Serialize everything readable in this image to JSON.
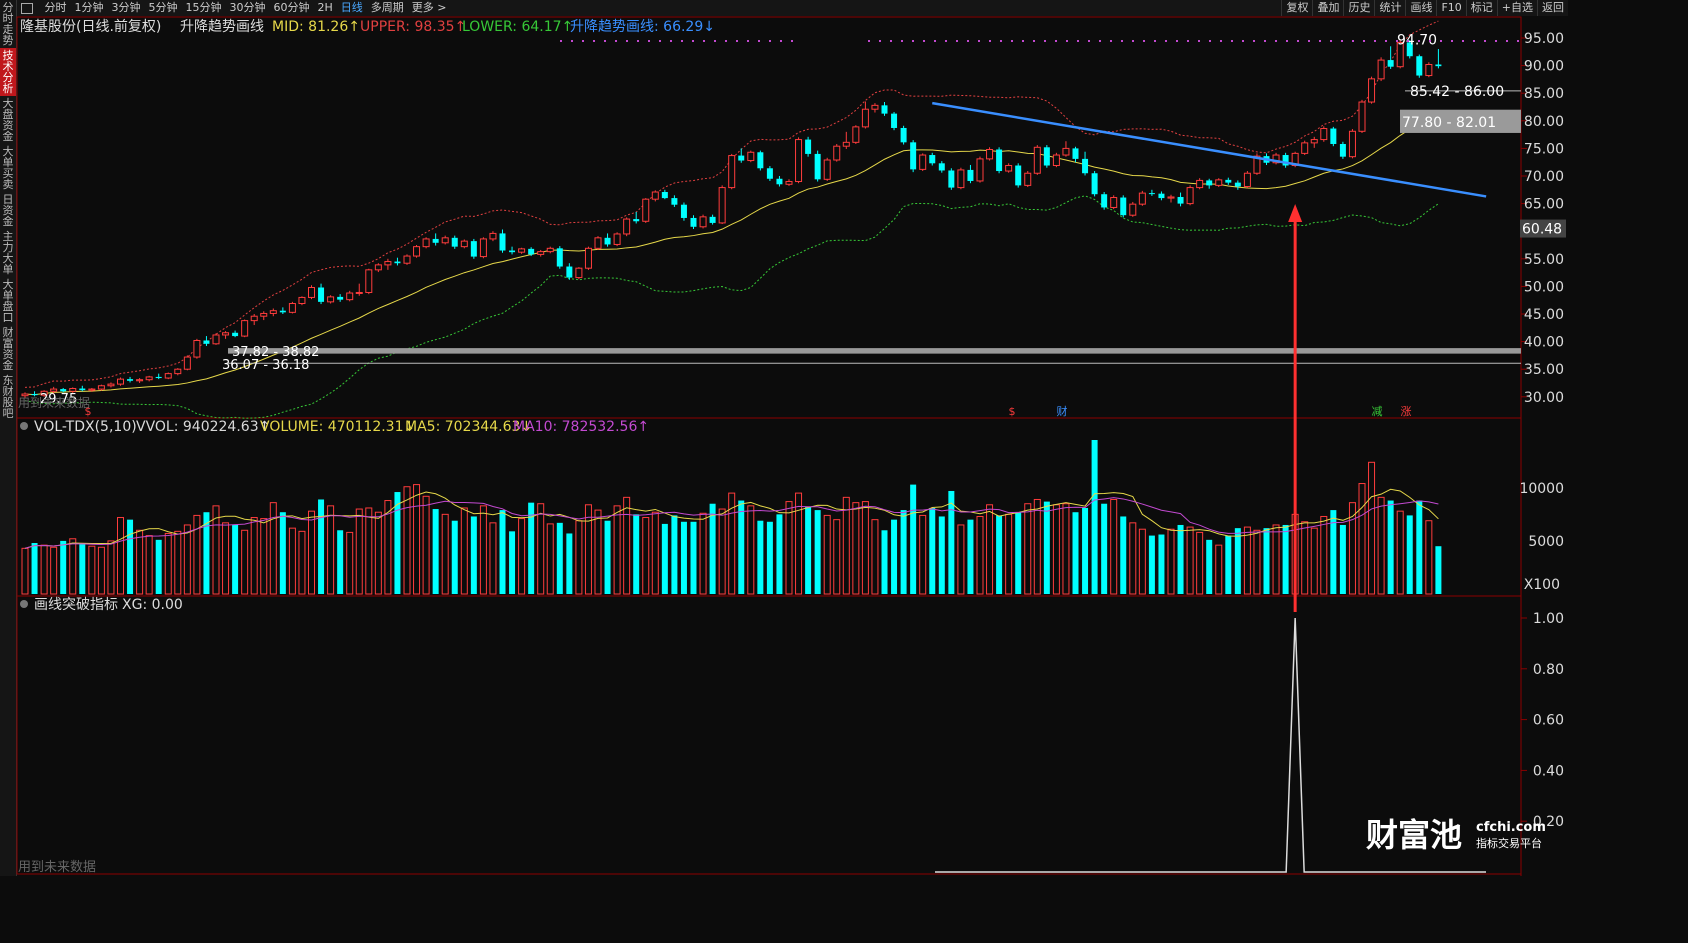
{
  "sidebar": {
    "items": [
      "分时走势",
      "技术分析",
      "大盘资金",
      "大单买卖",
      "日资金",
      "主力大单",
      "大单盘口",
      "财富资金",
      "东财股吧"
    ],
    "active": 1
  },
  "topbar": {
    "periods": [
      "分时",
      "1分钟",
      "3分钟",
      "5分钟",
      "15分钟",
      "30分钟",
      "60分钟",
      "2H",
      "日线",
      "多周期",
      "更多 >"
    ],
    "active_period": "日线",
    "right_menu": [
      "复权",
      "叠加",
      "历史",
      "统计",
      "画线",
      "F10",
      "标记",
      "+自选",
      "返回"
    ]
  },
  "indicator_bar": {
    "stock": "隆基股份(日线.前复权)",
    "study": "升降趋势画线",
    "items": [
      {
        "text": "MID: 81.26↑",
        "color": "#e6d84a"
      },
      {
        "text": "UPPER: 98.35↑",
        "color": "#e04040"
      },
      {
        "text": "LOWER: 64.17↑",
        "color": "#37c837"
      },
      {
        "text": "升降趋势画线: 66.29↓",
        "color": "#3a8fff"
      }
    ]
  },
  "vol_bar": {
    "name": "VOL-TDX(5,10)",
    "items": [
      {
        "text": "VVOL: 940224.63↑",
        "color": "#d8d8d8"
      },
      {
        "text": "VOLUME: 470112.31↓",
        "color": "#e6d84a"
      },
      {
        "text": "MA5: 702344.63↓",
        "color": "#e6d84a"
      },
      {
        "text": "MA10: 782532.56↑",
        "color": "#c34ad1"
      }
    ]
  },
  "xg_bar": {
    "name": "画线突破指标",
    "value": "XG: 0.00"
  },
  "annotations": {
    "high": "94.70",
    "box_top": "85.42 - 86.00",
    "box_mid": "77.80 - 82.01",
    "cur_price": "60.48",
    "box_low1": "37.82 - 38.82",
    "box_low2": "36.07 - 36.18",
    "low": "29.75",
    "marks": [
      "$",
      "$",
      "财",
      "减",
      "涨"
    ],
    "future_note": "用到未来数据",
    "future_note2": "用到未来数据"
  },
  "watermark": {
    "brand": "财富池",
    "site": "cfchi.com",
    "sub": "指标交易平台"
  },
  "colors": {
    "up": "#ff3c3c",
    "down": "#00ffff",
    "mid": "#e6d84a",
    "upper": "#e04040",
    "lower": "#37c837",
    "trend": "#3a8fff",
    "ma10": "#c34ad1",
    "arrow": "#ff3030",
    "grid": "#8b0000"
  },
  "chart_data": {
    "type": "candlestick",
    "price_axis": {
      "ticks": [
        95,
        90,
        85,
        80,
        75,
        70,
        65,
        60,
        55,
        50,
        45,
        40,
        35,
        30
      ],
      "labels": [
        "95.00",
        "90.00",
        "85.00",
        "80.00",
        "75.00",
        "70.00",
        "65.00",
        "60.00",
        "55.00",
        "50.00",
        "45.00",
        "40.00",
        "35.00",
        "30.00"
      ]
    },
    "volume_axis": {
      "labels": [
        "10000",
        "5000"
      ],
      "unit": "X100"
    },
    "xg_axis": {
      "labels": [
        "1.00",
        "0.80",
        "0.60",
        "0.40",
        "0.20"
      ]
    },
    "candles": [
      [
        30.2,
        30.8,
        29.8,
        30.5
      ],
      [
        30.5,
        31.0,
        30.1,
        30.3
      ],
      [
        30.3,
        31.2,
        30.0,
        31.0
      ],
      [
        31.0,
        31.8,
        30.6,
        31.4
      ],
      [
        31.4,
        31.6,
        30.8,
        31.0
      ],
      [
        31.0,
        31.7,
        30.7,
        31.5
      ],
      [
        31.5,
        32.0,
        31.0,
        31.2
      ],
      [
        31.2,
        31.6,
        30.9,
        31.4
      ],
      [
        31.4,
        32.2,
        31.1,
        32.0
      ],
      [
        32.0,
        32.6,
        31.7,
        32.3
      ],
      [
        32.3,
        33.5,
        32.0,
        33.2
      ],
      [
        33.2,
        33.6,
        32.6,
        32.9
      ],
      [
        32.9,
        33.4,
        32.5,
        33.1
      ],
      [
        33.1,
        33.8,
        32.8,
        33.6
      ],
      [
        33.6,
        34.2,
        33.2,
        33.4
      ],
      [
        33.4,
        34.4,
        33.2,
        34.2
      ],
      [
        34.2,
        35.2,
        33.9,
        35.0
      ],
      [
        35.0,
        37.5,
        34.8,
        37.2
      ],
      [
        37.2,
        40.5,
        36.9,
        40.2
      ],
      [
        40.2,
        41.0,
        39.2,
        39.6
      ],
      [
        39.6,
        41.5,
        39.4,
        41.2
      ],
      [
        41.2,
        41.9,
        40.5,
        41.6
      ],
      [
        41.6,
        42.0,
        40.8,
        41.0
      ],
      [
        41.0,
        44.0,
        40.8,
        43.8
      ],
      [
        43.8,
        45.0,
        43.0,
        44.6
      ],
      [
        44.6,
        45.5,
        43.9,
        45.1
      ],
      [
        45.1,
        46.0,
        44.6,
        45.6
      ],
      [
        45.6,
        46.2,
        45.0,
        45.3
      ],
      [
        45.3,
        47.2,
        45.1,
        46.9
      ],
      [
        46.9,
        48.2,
        46.6,
        48.0
      ],
      [
        48.0,
        50.2,
        47.7,
        49.8
      ],
      [
        49.8,
        50.5,
        46.8,
        47.2
      ],
      [
        47.2,
        48.4,
        46.9,
        48.1
      ],
      [
        48.1,
        48.6,
        47.2,
        47.6
      ],
      [
        47.6,
        49.2,
        47.3,
        48.8
      ],
      [
        48.8,
        50.5,
        48.3,
        48.9
      ],
      [
        48.9,
        53.2,
        48.6,
        53.0
      ],
      [
        53.0,
        54.2,
        52.6,
        53.9
      ],
      [
        53.9,
        55.0,
        53.0,
        54.5
      ],
      [
        54.5,
        55.2,
        53.8,
        54.2
      ],
      [
        54.2,
        55.8,
        53.9,
        55.5
      ],
      [
        55.5,
        57.5,
        55.2,
        57.2
      ],
      [
        57.2,
        58.9,
        56.9,
        58.6
      ],
      [
        58.6,
        59.6,
        57.4,
        57.9
      ],
      [
        57.9,
        59.2,
        57.6,
        58.8
      ],
      [
        58.8,
        59.2,
        56.8,
        57.2
      ],
      [
        57.2,
        58.5,
        56.9,
        58.2
      ],
      [
        58.2,
        58.6,
        55.0,
        55.4
      ],
      [
        55.4,
        58.9,
        55.1,
        58.6
      ],
      [
        58.6,
        60.0,
        58.2,
        59.6
      ],
      [
        59.6,
        60.3,
        56.1,
        56.5
      ],
      [
        56.5,
        57.2,
        55.8,
        56.2
      ],
      [
        56.2,
        57.0,
        55.9,
        56.8
      ],
      [
        56.8,
        57.1,
        55.5,
        55.8
      ],
      [
        55.8,
        56.6,
        55.4,
        56.3
      ],
      [
        56.3,
        57.2,
        56.0,
        56.9
      ],
      [
        56.9,
        57.3,
        53.2,
        53.6
      ],
      [
        53.6,
        54.2,
        51.2,
        51.6
      ],
      [
        51.6,
        53.5,
        51.3,
        53.3
      ],
      [
        53.3,
        57.2,
        53.0,
        56.9
      ],
      [
        56.9,
        59.1,
        56.6,
        58.8
      ],
      [
        58.8,
        59.6,
        57.2,
        57.6
      ],
      [
        57.6,
        59.8,
        57.3,
        59.5
      ],
      [
        59.5,
        62.5,
        59.1,
        62.2
      ],
      [
        62.2,
        63.5,
        61.4,
        61.8
      ],
      [
        61.8,
        66.0,
        61.5,
        65.8
      ],
      [
        65.8,
        67.4,
        65.4,
        67.1
      ],
      [
        67.1,
        67.5,
        65.8,
        66.0
      ],
      [
        66.0,
        66.5,
        64.4,
        64.8
      ],
      [
        64.8,
        65.2,
        61.9,
        62.4
      ],
      [
        62.4,
        62.9,
        60.4,
        60.8
      ],
      [
        60.8,
        63.0,
        60.5,
        62.6
      ],
      [
        62.6,
        63.0,
        61.2,
        61.5
      ],
      [
        61.5,
        68.3,
        61.3,
        67.9
      ],
      [
        67.9,
        74.0,
        67.6,
        73.7
      ],
      [
        73.7,
        75.0,
        72.4,
        72.8
      ],
      [
        72.8,
        74.6,
        72.5,
        74.3
      ],
      [
        74.3,
        74.6,
        71.0,
        71.4
      ],
      [
        71.4,
        71.8,
        69.1,
        69.5
      ],
      [
        69.5,
        70.0,
        68.1,
        68.5
      ],
      [
        68.5,
        69.4,
        68.2,
        69.0
      ],
      [
        69.0,
        77.0,
        68.7,
        76.6
      ],
      [
        76.6,
        77.1,
        73.5,
        74.0
      ],
      [
        74.0,
        74.6,
        69.0,
        69.4
      ],
      [
        69.4,
        73.3,
        69.1,
        72.9
      ],
      [
        72.9,
        75.8,
        72.6,
        75.4
      ],
      [
        75.4,
        78.0,
        74.9,
        76.1
      ],
      [
        76.1,
        79.2,
        75.8,
        78.9
      ],
      [
        78.9,
        83.5,
        78.6,
        82.1
      ],
      [
        82.1,
        83.2,
        81.5,
        82.8
      ],
      [
        82.8,
        83.4,
        80.9,
        81.3
      ],
      [
        81.3,
        81.6,
        78.3,
        78.7
      ],
      [
        78.7,
        79.1,
        75.7,
        76.1
      ],
      [
        76.1,
        76.5,
        70.7,
        71.2
      ],
      [
        71.2,
        74.1,
        70.9,
        73.8
      ],
      [
        73.8,
        74.2,
        71.9,
        72.3
      ],
      [
        72.3,
        72.7,
        70.6,
        71.0
      ],
      [
        71.0,
        71.4,
        67.5,
        67.9
      ],
      [
        67.9,
        71.5,
        67.6,
        71.1
      ],
      [
        71.1,
        72.0,
        68.7,
        69.1
      ],
      [
        69.1,
        73.5,
        68.8,
        73.1
      ],
      [
        73.1,
        75.2,
        72.8,
        74.8
      ],
      [
        74.8,
        75.2,
        70.5,
        70.9
      ],
      [
        70.9,
        72.3,
        70.6,
        71.9
      ],
      [
        71.9,
        72.3,
        67.9,
        68.3
      ],
      [
        68.3,
        70.9,
        68.0,
        70.5
      ],
      [
        70.5,
        75.6,
        70.2,
        75.2
      ],
      [
        75.2,
        75.6,
        71.5,
        71.9
      ],
      [
        71.9,
        74.2,
        71.6,
        73.8
      ],
      [
        73.8,
        76.3,
        73.5,
        75.0
      ],
      [
        75.0,
        75.3,
        72.5,
        73.1
      ],
      [
        73.1,
        74.4,
        70.1,
        70.5
      ],
      [
        70.5,
        70.9,
        66.3,
        66.7
      ],
      [
        66.7,
        67.1,
        63.9,
        64.3
      ],
      [
        64.3,
        66.5,
        64.0,
        66.1
      ],
      [
        66.1,
        66.5,
        62.5,
        62.9
      ],
      [
        62.9,
        65.3,
        62.6,
        64.9
      ],
      [
        64.9,
        67.3,
        64.6,
        66.9
      ],
      [
        66.9,
        67.5,
        66.4,
        66.8
      ],
      [
        66.8,
        67.2,
        65.6,
        66.0
      ],
      [
        66.0,
        66.6,
        65.2,
        66.2
      ],
      [
        66.2,
        67.0,
        64.5,
        65.0
      ],
      [
        65.0,
        68.3,
        64.7,
        67.9
      ],
      [
        67.9,
        69.6,
        67.6,
        69.2
      ],
      [
        69.2,
        69.5,
        67.7,
        68.3
      ],
      [
        68.3,
        69.6,
        68.0,
        69.3
      ],
      [
        69.3,
        69.7,
        68.4,
        68.8
      ],
      [
        68.8,
        69.2,
        67.5,
        68.1
      ],
      [
        68.1,
        70.9,
        67.8,
        70.5
      ],
      [
        70.5,
        74.1,
        70.2,
        73.6
      ],
      [
        73.6,
        74.1,
        72.0,
        72.4
      ],
      [
        72.4,
        74.2,
        72.1,
        73.8
      ],
      [
        73.8,
        74.2,
        71.5,
        71.9
      ],
      [
        71.9,
        74.4,
        71.6,
        74.1
      ],
      [
        74.1,
        76.4,
        73.8,
        76.0
      ],
      [
        76.0,
        77.1,
        75.1,
        76.6
      ],
      [
        76.6,
        79.0,
        76.2,
        78.6
      ],
      [
        78.6,
        78.9,
        75.4,
        75.8
      ],
      [
        75.8,
        76.2,
        73.1,
        73.5
      ],
      [
        73.5,
        78.5,
        73.2,
        78.1
      ],
      [
        78.1,
        83.8,
        77.8,
        83.4
      ],
      [
        83.4,
        88.0,
        83.1,
        87.6
      ],
      [
        87.6,
        91.5,
        87.2,
        91.0
      ],
      [
        91.0,
        93.5,
        89.4,
        89.8
      ],
      [
        89.8,
        94.7,
        89.5,
        94.2
      ],
      [
        94.2,
        94.6,
        91.3,
        91.7
      ],
      [
        91.7,
        92.0,
        87.8,
        88.2
      ],
      [
        88.2,
        90.6,
        87.9,
        90.2
      ],
      [
        90.2,
        93.0,
        89.5,
        89.9
      ]
    ],
    "volumes": [
      4300,
      4800,
      4600,
      4400,
      5000,
      5200,
      4700,
      4500,
      4400,
      5000,
      7200,
      7000,
      6000,
      5500,
      5100,
      5700,
      5900,
      6500,
      7400,
      7700,
      8300,
      6700,
      6500,
      6000,
      7200,
      7100,
      8600,
      7700,
      6200,
      5900,
      7800,
      8900,
      8300,
      6000,
      5800,
      8000,
      8100,
      7700,
      8800,
      9600,
      10100,
      10300,
      9200,
      8000,
      7500,
      6900,
      8100,
      7300,
      8300,
      6700,
      7900,
      5900,
      7100,
      8600,
      8500,
      6600,
      6700,
      5700,
      6900,
      8400,
      7900,
      6900,
      8300,
      9100,
      7500,
      7200,
      7700,
      6600,
      7400,
      6800,
      6800,
      7600,
      8500,
      8000,
      9500,
      8800,
      8300,
      6900,
      6800,
      7500,
      8700,
      9500,
      8200,
      7900,
      7400,
      7000,
      9100,
      8600,
      8700,
      7000,
      6000,
      7000,
      7900,
      10300,
      7400,
      8100,
      7300,
      9700,
      6500,
      7000,
      7300,
      8400,
      7400,
      7500,
      7700,
      8500,
      8900,
      8700,
      8400,
      8500,
      7700,
      8100,
      14500,
      8500,
      8900,
      7300,
      6700,
      6100,
      5500,
      5600,
      6100,
      6500,
      6300,
      5800,
      5100,
      4600,
      5500,
      6200,
      6300,
      6000,
      6200,
      6500,
      6500,
      7500,
      6800,
      6200,
      7300,
      7900,
      6500,
      8600,
      10400,
      12400,
      9100,
      8800,
      7800,
      7400,
      8800,
      6900,
      4500
    ],
    "trend_line": {
      "from": {
        "idx": 95,
        "price": 83.2
      },
      "to": {
        "idx": 153,
        "price": 66.3
      }
    },
    "xg_signal_idx": 133,
    "xg_peak": 1.0
  }
}
